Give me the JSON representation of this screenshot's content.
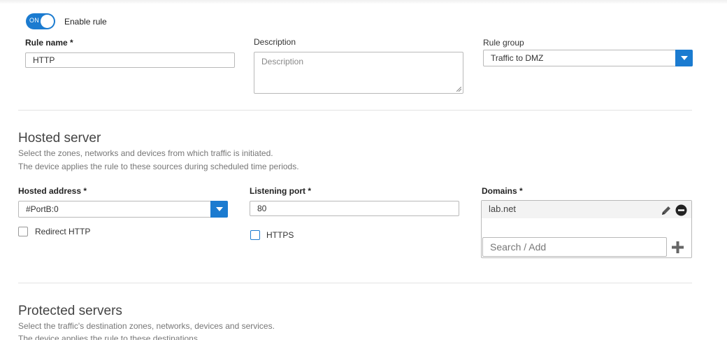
{
  "rule": {
    "toggle_state": "ON",
    "enable_label": "Enable rule",
    "name_label": "Rule name *",
    "name_value": "HTTP",
    "description_label": "Description",
    "description_placeholder": "Description",
    "group_label": "Rule group",
    "group_value": "Traffic to DMZ"
  },
  "hosted_server": {
    "title": "Hosted server",
    "desc_line1": "Select the zones, networks and devices from which traffic is initiated.",
    "desc_line2": "The device applies the rule to these sources during scheduled time periods.",
    "address_label": "Hosted address *",
    "address_value": "#PortB:0",
    "redirect_label": "Redirect HTTP",
    "port_label": "Listening port *",
    "port_value": "80",
    "https_label": "HTTPS",
    "domains_label": "Domains *",
    "domains": [
      "lab.net"
    ],
    "search_placeholder": "Search / Add"
  },
  "protected_servers": {
    "title": "Protected servers",
    "desc_line1": "Select the traffic's destination zones, networks, devices and services.",
    "desc_line2": "The device applies the rule to these destinations."
  },
  "colors": {
    "accent": "#1b7bd0"
  },
  "icons": {
    "edit": "pencil-icon",
    "remove": "minus-circle-icon",
    "add": "plus-icon"
  }
}
